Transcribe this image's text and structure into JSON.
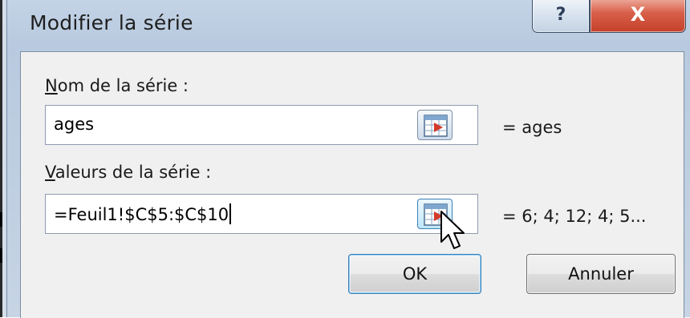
{
  "dialog": {
    "title": "Modifier la série",
    "help_label": "?",
    "close_label": "X"
  },
  "series_name": {
    "label_accel": "N",
    "label_rest": "om de la série :",
    "value": "ages",
    "preview": "= ages"
  },
  "series_values": {
    "label_accel": "V",
    "label_rest": "aleurs de la série :",
    "value": "=Feuil1!$C$5:$C$10",
    "preview": "= 6; 4; 12; 4; 5..."
  },
  "buttons": {
    "ok_label": "OK",
    "cancel_label": "Annuler"
  },
  "icons": {
    "range_button": "range-select-icon",
    "cursor": "mouse-pointer-icon"
  }
}
